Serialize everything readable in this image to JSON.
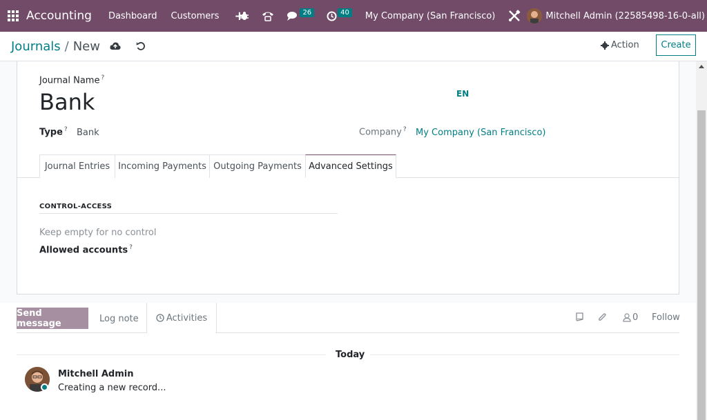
{
  "navbar": {
    "app_name": "Accounting",
    "menus": [
      "Dashboard",
      "Customers"
    ],
    "messages_count": "26",
    "activities_count": "40",
    "company": "My Company (San Francisco)",
    "user": "Mitchell Admin (22585498-16-0-all)"
  },
  "control": {
    "breadcrumb_parent": "Journals",
    "breadcrumb_sep": "/",
    "breadcrumb_current": "New",
    "action_label": "Action",
    "create_label": "Create"
  },
  "form": {
    "journal_name_label": "Journal Name",
    "help_mark": "?",
    "journal_name_value": "Bank",
    "lang": "EN",
    "type_label": "Type",
    "type_value": "Bank",
    "company_label": "Company",
    "company_value": "My Company (San Francisco)",
    "tabs": [
      "Journal Entries",
      "Incoming Payments",
      "Outgoing Payments",
      "Advanced Settings"
    ],
    "active_tab": "Advanced Settings",
    "section_title": "CONTROL-ACCESS",
    "allowed_placeholder": "Keep empty for no control",
    "allowed_label": "Allowed accounts"
  },
  "chatter": {
    "send_message": "Send message",
    "log_note": "Log note",
    "activities": "Activities",
    "followers_count": "0",
    "follow": "Follow",
    "today": "Today",
    "author": "Mitchell Admin",
    "message": "Creating a new record..."
  },
  "colors": {
    "brand": "#714b67",
    "accent": "#017e84"
  }
}
